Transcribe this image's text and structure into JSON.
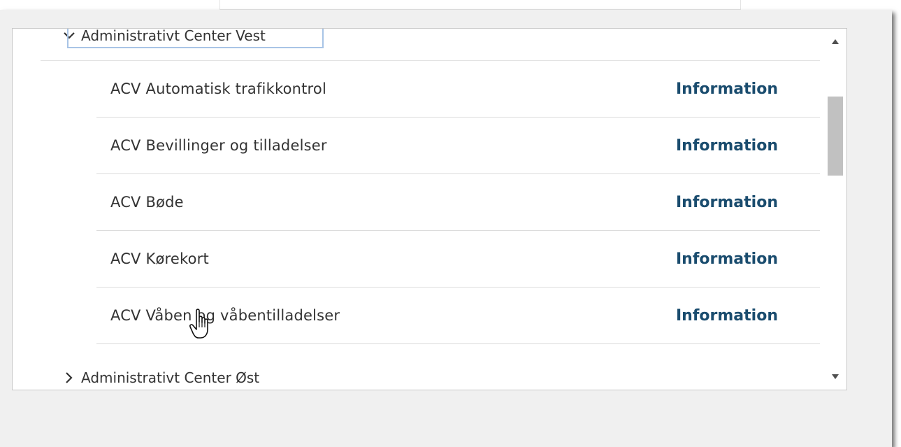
{
  "tree": {
    "group_top_label": "Administrativt Center Vest",
    "group_bottom_label": "Administrativt Center Øst",
    "items": [
      {
        "label": "ACV Automatisk trafikkontrol",
        "link": "Information"
      },
      {
        "label": "ACV Bevillinger og tilladelser",
        "link": "Information"
      },
      {
        "label": "ACV Bøde",
        "link": "Information"
      },
      {
        "label": "ACV Kørekort",
        "link": "Information"
      },
      {
        "label": "ACV Våben og våbentilladelser",
        "link": "Information"
      }
    ]
  },
  "scrollbar": {
    "position_fraction": 0.18
  },
  "icons": {
    "expanded": "chevron-down-icon",
    "collapsed": "chevron-right-icon",
    "scroll_up": "triangle-up-icon",
    "scroll_down": "triangle-down-icon",
    "cursor": "hand-pointer-icon"
  },
  "colors": {
    "link": "#1a4c6e",
    "text": "#333333",
    "dialog_background": "#f0f0f0",
    "focus_outline": "#a8c4e6"
  }
}
